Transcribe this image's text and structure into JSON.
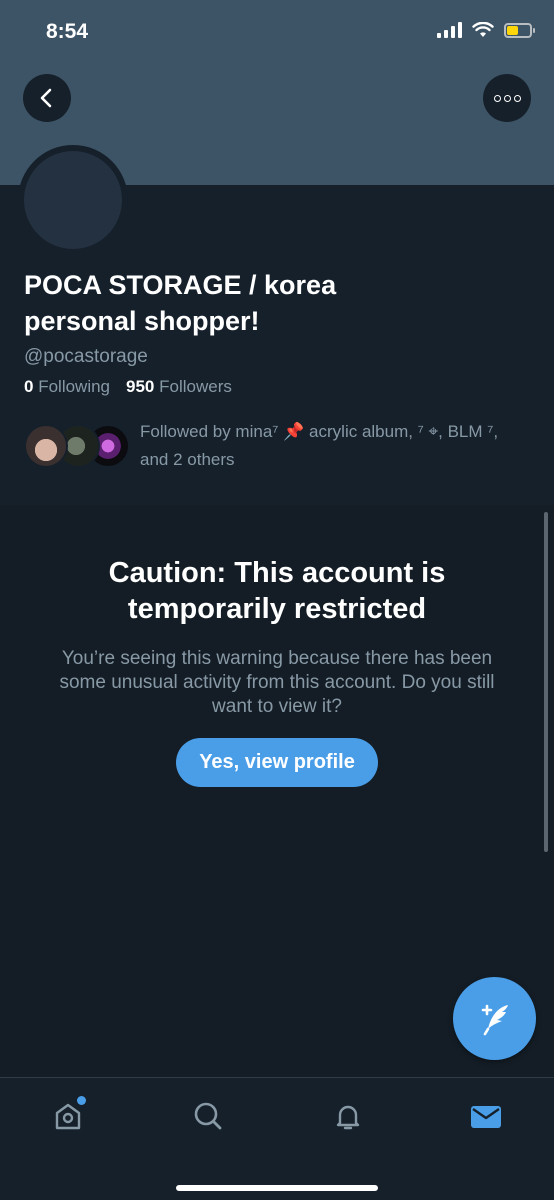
{
  "status_bar": {
    "time": "8:54",
    "battery_level": 0.5,
    "battery_color": "#ffd60a"
  },
  "header": {
    "back_icon": "chevron-left-icon",
    "more_icon": "more-dots-icon",
    "banner_color": "#3d5466"
  },
  "profile": {
    "display_name": "POCA STORAGE / korea personal shopper!",
    "handle": "@pocastorage",
    "following_count": "0",
    "following_label": "Following",
    "followers_count": "950",
    "followers_label": "Followers",
    "followed_by_text": "Followed by mina⁷ 📌 acrylic album, ⁷ ⌖, BLM ⁷, and 2 others"
  },
  "caution": {
    "title": "Caution: This account is temporarily restricted",
    "body": "You’re seeing this warning because there has been some unusual activity from this account. Do you still want to view it?",
    "button_label": "Yes, view profile"
  },
  "fab": {
    "icon": "compose-tweet-icon"
  },
  "tabbar": {
    "items": [
      {
        "name": "home",
        "icon": "home-icon",
        "active": false,
        "has_dot": true
      },
      {
        "name": "search",
        "icon": "search-icon",
        "active": false
      },
      {
        "name": "notifications",
        "icon": "bell-icon",
        "active": false
      },
      {
        "name": "messages",
        "icon": "mail-icon",
        "active": true
      }
    ]
  },
  "colors": {
    "accent": "#4a9ee8",
    "background": "#15202b",
    "secondary_text": "#8899a6"
  }
}
